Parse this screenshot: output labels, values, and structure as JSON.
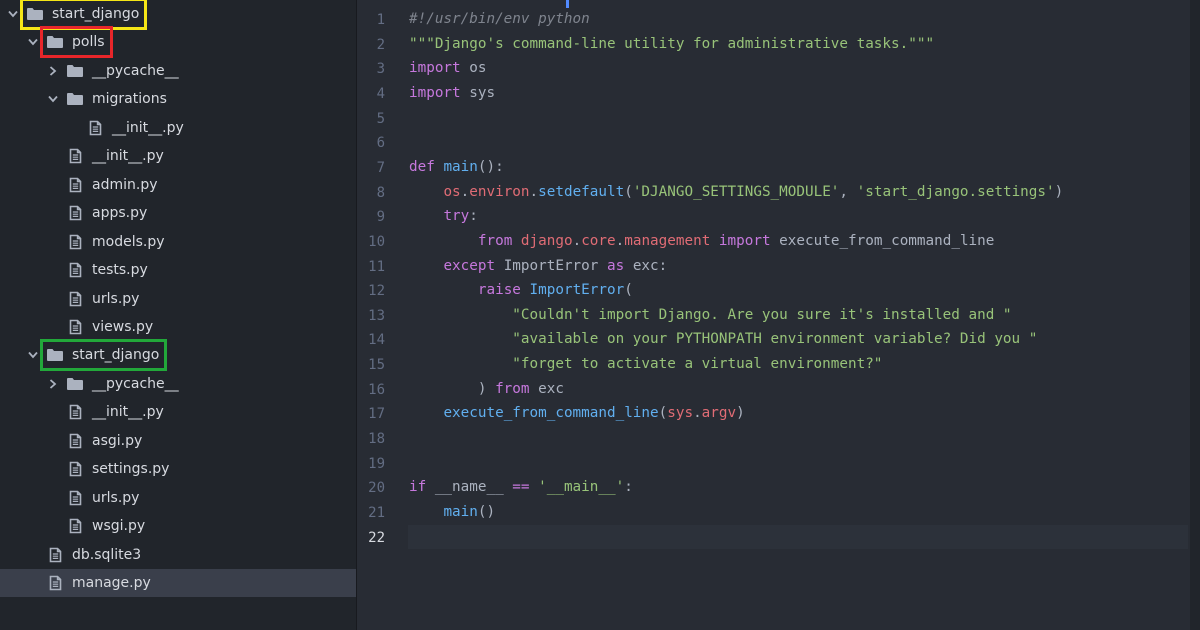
{
  "sidebar": {
    "rows": [
      {
        "label": "start_django",
        "indent": 0,
        "kind": "folder",
        "chevron": "open",
        "selected": false
      },
      {
        "label": "polls",
        "indent": 1,
        "kind": "folder",
        "chevron": "open",
        "selected": false
      },
      {
        "label": "__pycache__",
        "indent": 2,
        "kind": "folder",
        "chevron": "closed",
        "selected": false
      },
      {
        "label": "migrations",
        "indent": 2,
        "kind": "folder",
        "chevron": "open",
        "selected": false
      },
      {
        "label": "__init__.py",
        "indent": 3,
        "kind": "file",
        "chevron": "none",
        "selected": false
      },
      {
        "label": "__init__.py",
        "indent": 2,
        "kind": "file",
        "chevron": "none",
        "selected": false
      },
      {
        "label": "admin.py",
        "indent": 2,
        "kind": "file",
        "chevron": "none",
        "selected": false
      },
      {
        "label": "apps.py",
        "indent": 2,
        "kind": "file",
        "chevron": "none",
        "selected": false
      },
      {
        "label": "models.py",
        "indent": 2,
        "kind": "file",
        "chevron": "none",
        "selected": false
      },
      {
        "label": "tests.py",
        "indent": 2,
        "kind": "file",
        "chevron": "none",
        "selected": false
      },
      {
        "label": "urls.py",
        "indent": 2,
        "kind": "file",
        "chevron": "none",
        "selected": false
      },
      {
        "label": "views.py",
        "indent": 2,
        "kind": "file",
        "chevron": "none",
        "selected": false
      },
      {
        "label": "start_django",
        "indent": 1,
        "kind": "folder",
        "chevron": "open",
        "selected": false
      },
      {
        "label": "__pycache__",
        "indent": 2,
        "kind": "folder",
        "chevron": "closed",
        "selected": false
      },
      {
        "label": "__init__.py",
        "indent": 2,
        "kind": "file",
        "chevron": "none",
        "selected": false
      },
      {
        "label": "asgi.py",
        "indent": 2,
        "kind": "file",
        "chevron": "none",
        "selected": false
      },
      {
        "label": "settings.py",
        "indent": 2,
        "kind": "file",
        "chevron": "none",
        "selected": false
      },
      {
        "label": "urls.py",
        "indent": 2,
        "kind": "file",
        "chevron": "none",
        "selected": false
      },
      {
        "label": "wsgi.py",
        "indent": 2,
        "kind": "file",
        "chevron": "none",
        "selected": false
      },
      {
        "label": "db.sqlite3",
        "indent": 1,
        "kind": "file",
        "chevron": "none",
        "selected": false
      },
      {
        "label": "manage.py",
        "indent": 1,
        "kind": "file",
        "chevron": "none",
        "selected": true
      }
    ],
    "highlights": [
      {
        "row": 0,
        "color": "#f5e617"
      },
      {
        "row": 1,
        "color": "#e8262a"
      },
      {
        "row": 12,
        "color": "#22a83a"
      }
    ]
  },
  "editor": {
    "current_line": 22,
    "lines": [
      [
        {
          "t": "#!/usr/bin/env python",
          "c": "comment"
        }
      ],
      [
        {
          "t": "\"\"\"Django's command-line utility for administrative tasks.\"\"\"",
          "c": "string"
        }
      ],
      [
        {
          "t": "import",
          "c": "keyword"
        },
        {
          "t": " os",
          "c": "plain"
        }
      ],
      [
        {
          "t": "import",
          "c": "keyword"
        },
        {
          "t": " sys",
          "c": "plain"
        }
      ],
      [],
      [],
      [
        {
          "t": "def",
          "c": "keyword"
        },
        {
          "t": " ",
          "c": "plain"
        },
        {
          "t": "main",
          "c": "function"
        },
        {
          "t": "():",
          "c": "plain"
        }
      ],
      [
        {
          "t": "    ",
          "c": "plain"
        },
        {
          "t": "os",
          "c": "var"
        },
        {
          "t": ".",
          "c": "plain"
        },
        {
          "t": "environ",
          "c": "var"
        },
        {
          "t": ".",
          "c": "plain"
        },
        {
          "t": "setdefault",
          "c": "function"
        },
        {
          "t": "(",
          "c": "plain"
        },
        {
          "t": "'DJANGO_SETTINGS_MODULE'",
          "c": "string"
        },
        {
          "t": ", ",
          "c": "plain"
        },
        {
          "t": "'start_django.settings'",
          "c": "string"
        },
        {
          "t": ")",
          "c": "plain"
        }
      ],
      [
        {
          "t": "    ",
          "c": "plain"
        },
        {
          "t": "try",
          "c": "keyword"
        },
        {
          "t": ":",
          "c": "plain"
        }
      ],
      [
        {
          "t": "        ",
          "c": "plain"
        },
        {
          "t": "from",
          "c": "keyword"
        },
        {
          "t": " ",
          "c": "plain"
        },
        {
          "t": "django",
          "c": "var"
        },
        {
          "t": ".",
          "c": "plain"
        },
        {
          "t": "core",
          "c": "var"
        },
        {
          "t": ".",
          "c": "plain"
        },
        {
          "t": "management",
          "c": "var"
        },
        {
          "t": " ",
          "c": "plain"
        },
        {
          "t": "import",
          "c": "keyword"
        },
        {
          "t": " execute_from_command_line",
          "c": "plain"
        }
      ],
      [
        {
          "t": "    ",
          "c": "plain"
        },
        {
          "t": "except",
          "c": "keyword"
        },
        {
          "t": " ImportError ",
          "c": "plain"
        },
        {
          "t": "as",
          "c": "keyword"
        },
        {
          "t": " exc:",
          "c": "plain"
        }
      ],
      [
        {
          "t": "        ",
          "c": "plain"
        },
        {
          "t": "raise",
          "c": "keyword"
        },
        {
          "t": " ",
          "c": "plain"
        },
        {
          "t": "ImportError",
          "c": "function"
        },
        {
          "t": "(",
          "c": "plain"
        }
      ],
      [
        {
          "t": "            ",
          "c": "plain"
        },
        {
          "t": "\"Couldn't import Django. Are you sure it's installed and \"",
          "c": "string"
        }
      ],
      [
        {
          "t": "            ",
          "c": "plain"
        },
        {
          "t": "\"available on your PYTHONPATH environment variable? Did you \"",
          "c": "string"
        }
      ],
      [
        {
          "t": "            ",
          "c": "plain"
        },
        {
          "t": "\"forget to activate a virtual environment?\"",
          "c": "string"
        }
      ],
      [
        {
          "t": "        ) ",
          "c": "plain"
        },
        {
          "t": "from",
          "c": "keyword"
        },
        {
          "t": " exc",
          "c": "plain"
        }
      ],
      [
        {
          "t": "    ",
          "c": "plain"
        },
        {
          "t": "execute_from_command_line",
          "c": "function"
        },
        {
          "t": "(",
          "c": "plain"
        },
        {
          "t": "sys",
          "c": "var"
        },
        {
          "t": ".",
          "c": "plain"
        },
        {
          "t": "argv",
          "c": "var"
        },
        {
          "t": ")",
          "c": "plain"
        }
      ],
      [],
      [],
      [
        {
          "t": "if",
          "c": "keyword"
        },
        {
          "t": " __name__ ",
          "c": "plain"
        },
        {
          "t": "==",
          "c": "keyword"
        },
        {
          "t": " ",
          "c": "plain"
        },
        {
          "t": "'__main__'",
          "c": "string"
        },
        {
          "t": ":",
          "c": "plain"
        }
      ],
      [
        {
          "t": "    ",
          "c": "plain"
        },
        {
          "t": "main",
          "c": "function"
        },
        {
          "t": "()",
          "c": "plain"
        }
      ],
      []
    ]
  }
}
